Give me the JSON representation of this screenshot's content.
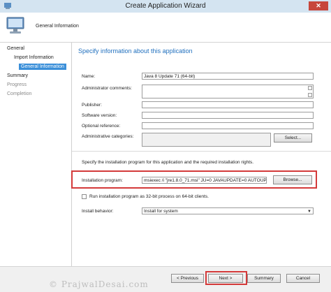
{
  "window": {
    "title": "Create Application Wizard",
    "close_label": "✕"
  },
  "header": {
    "title": "General Information"
  },
  "nav": {
    "items": [
      {
        "label": "General"
      },
      {
        "label": "Import Information"
      },
      {
        "label": "General Information"
      },
      {
        "label": "Summary"
      },
      {
        "label": "Progress"
      },
      {
        "label": "Completion"
      }
    ]
  },
  "content": {
    "heading": "Specify information about this application",
    "name_label": "Name:",
    "name_value": "Java 8 Update 71 (64-bit)",
    "admin_comments_label": "Administrator comments:",
    "admin_comments_value": "",
    "publisher_label": "Publisher:",
    "publisher_value": "",
    "software_version_label": "Software version:",
    "software_version_value": "",
    "optional_reference_label": "Optional reference:",
    "optional_reference_value": "",
    "admin_categories_label": "Administrative categories:",
    "admin_categories_value": "",
    "select_button": "Select...",
    "install_instructions": "Specify the installation program for this application and the required installation rights.",
    "install_program_label": "Installation program:",
    "install_program_value": "msiexec /i \"jre1.8.0_71.msi\" JU=0 JAVAUPDATE=0 AUTOUP",
    "browse_button": "Browse...",
    "run_32bit_label": "Run installation program as 32-bit process on 64-bit clients.",
    "run_32bit_checked": false,
    "install_behavior_label": "Install behavior:",
    "install_behavior_value": "Install for system"
  },
  "footer": {
    "previous": "< Previous",
    "next": "Next >",
    "summary": "Summary",
    "cancel": "Cancel"
  },
  "watermark": "© PrajwalDesai.com",
  "colors": {
    "accent": "#1f6fbe",
    "highlight": "#d43a3a",
    "selected": "#3a8fd9"
  }
}
